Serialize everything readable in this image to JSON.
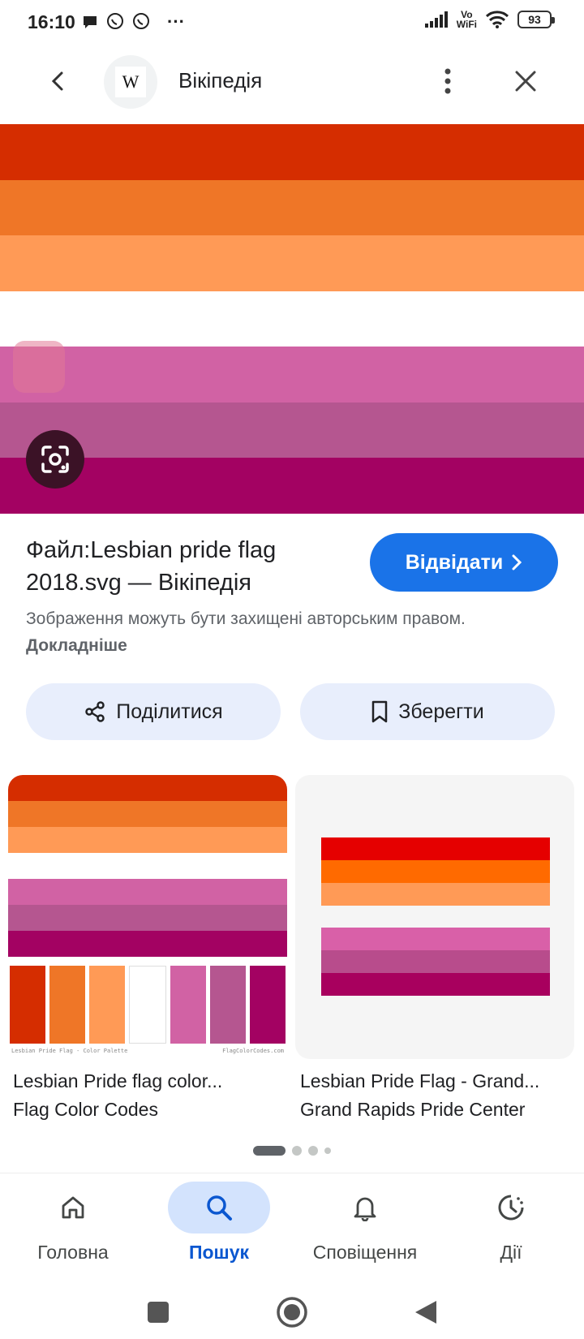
{
  "status_bar": {
    "time": "16:10",
    "more": "···",
    "vowifi_top": "Vo",
    "vowifi_bottom": "WiFi",
    "battery": "93"
  },
  "appbar": {
    "site_logo_letter": "W",
    "site_name": "Вікіпедія"
  },
  "flag": {
    "stripe_colors": [
      "#D52D00",
      "#EF7627",
      "#FF9A56",
      "#FFFFFF",
      "#D162A4",
      "#B55690",
      "#A30262"
    ]
  },
  "result": {
    "title": "Файл:Lesbian pride flag 2018.svg — Вікіпедія",
    "visit_label": "Відвідати",
    "copyright_text": "Зображення можуть бути захищені авторським правом.",
    "copyright_link": "Докладніше",
    "share_label": "Поділитися",
    "save_label": "Зберегти"
  },
  "related": [
    {
      "title": "Lesbian Pride flag color...",
      "source": "Flag Color Codes",
      "swatches": [
        "#D52D00",
        "#EF7627",
        "#FF9A56",
        "#FFFFFF",
        "#D162A4",
        "#B55690",
        "#A30262"
      ],
      "caption_left": "Lesbian Pride Flag - Color Palette",
      "caption_right": "FlagColorCodes.com"
    },
    {
      "title": "Lesbian Pride Flag - Grand...",
      "source": "Grand Rapids Pride Center",
      "top_colors": [
        "#E50000",
        "#FF6A00",
        "#FF9A56"
      ],
      "bottom_colors": [
        "#D960A8",
        "#B84C8C",
        "#A8005E"
      ]
    }
  ],
  "pager": {
    "count": 4,
    "active": 0
  },
  "bottom_nav": [
    {
      "label": "Головна",
      "icon": "home-icon"
    },
    {
      "label": "Пошук",
      "icon": "search-icon",
      "active": true
    },
    {
      "label": "Сповіщення",
      "icon": "bell-icon"
    },
    {
      "label": "Дії",
      "icon": "activity-icon"
    }
  ],
  "colors": {
    "accent": "#1A73E8",
    "nav_active": "#0B57D0",
    "pill_bg": "#E8EEFC"
  }
}
